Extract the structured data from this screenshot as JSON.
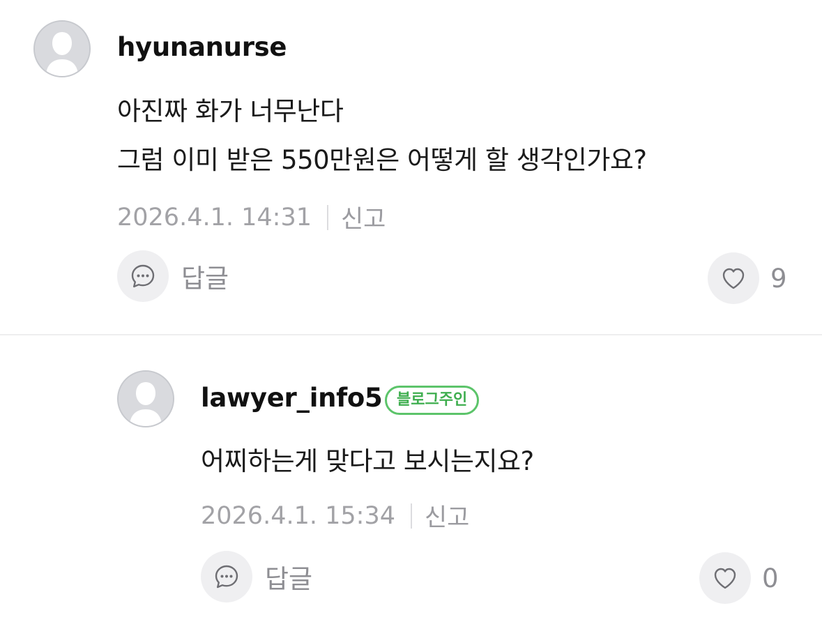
{
  "comments": [
    {
      "username": "hyunanurse",
      "lines": [
        "아진짜 화가 너무난다",
        "그럼 이미 받은 550만원은 어떻게 할 생각인가요?"
      ],
      "timestamp": "2026.4.1. 14:31",
      "report_label": "신고",
      "reply_label": "답글",
      "like_count": "9"
    },
    {
      "username": "lawyer_info5",
      "badge": "블로그주인",
      "lines": [
        "어찌하는게 맞다고 보시는지요?"
      ],
      "timestamp": "2026.4.1. 15:34",
      "report_label": "신고",
      "reply_label": "답글",
      "like_count": "0"
    }
  ],
  "colors": {
    "badge": "#5cc46a",
    "muted_text": "#a2a2a6",
    "button_bg": "#efeff1",
    "avatar_bg": "#d9dade"
  },
  "icons": {
    "avatar": "default-avatar-icon",
    "reply": "speech-bubble-icon",
    "like": "heart-icon"
  }
}
